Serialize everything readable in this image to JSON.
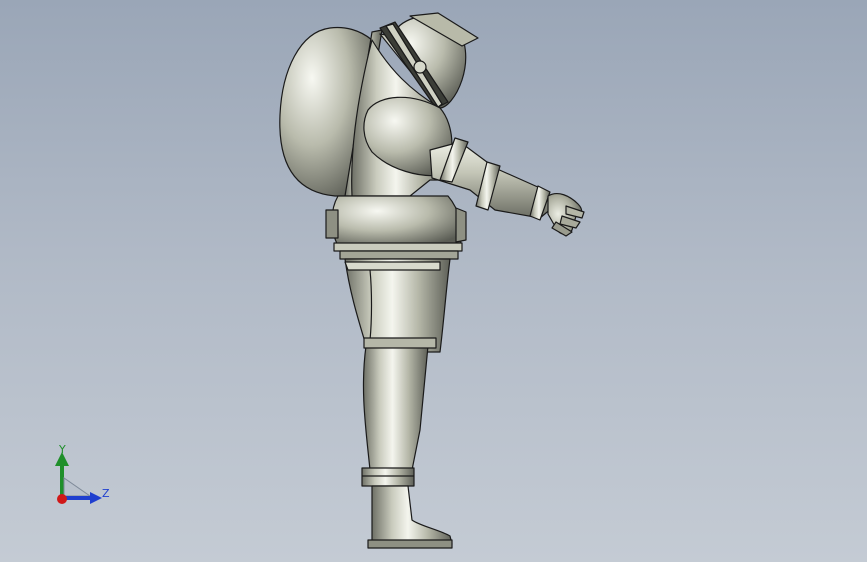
{
  "viewport": {
    "background_top": "#9aa6b7",
    "background_bottom": "#c4cbd4",
    "model": {
      "subject": "astronaut-spacesuit",
      "view": "side",
      "material_color": "#c2c4b4",
      "edge_color": "#1a1a1a"
    }
  },
  "triad": {
    "y_label": "Y",
    "z_label": "Z",
    "y_color": "#1f8f2a",
    "z_color": "#1f3fcf",
    "x_color": "#d01818"
  }
}
